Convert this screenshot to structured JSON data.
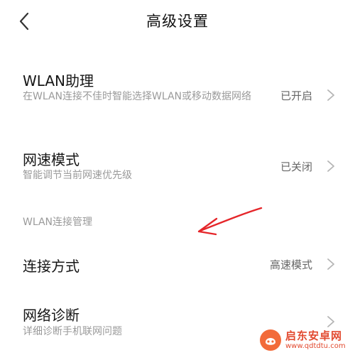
{
  "header": {
    "title": "高级设置",
    "back_icon": "chevron-left-icon"
  },
  "rows": [
    {
      "title": "WLAN助理",
      "subtitle": "在WLAN连接不佳时智能选择WLAN或移动数据网络",
      "status": "已开启"
    },
    {
      "title": "网速模式",
      "subtitle": "智能调节当前网速优先级",
      "status": "已关闭"
    },
    {
      "title": "连接方式",
      "subtitle": "",
      "status": "高速模式"
    },
    {
      "title": "网络诊断",
      "subtitle": "详细诊断手机联网问题",
      "status": ""
    }
  ],
  "section": {
    "label": "WLAN连接管理"
  },
  "annotation": {
    "color": "#e5262a"
  },
  "watermark": {
    "name": "启东安卓网",
    "url": "www.qdtdtu.com",
    "color": "#e24a30"
  }
}
